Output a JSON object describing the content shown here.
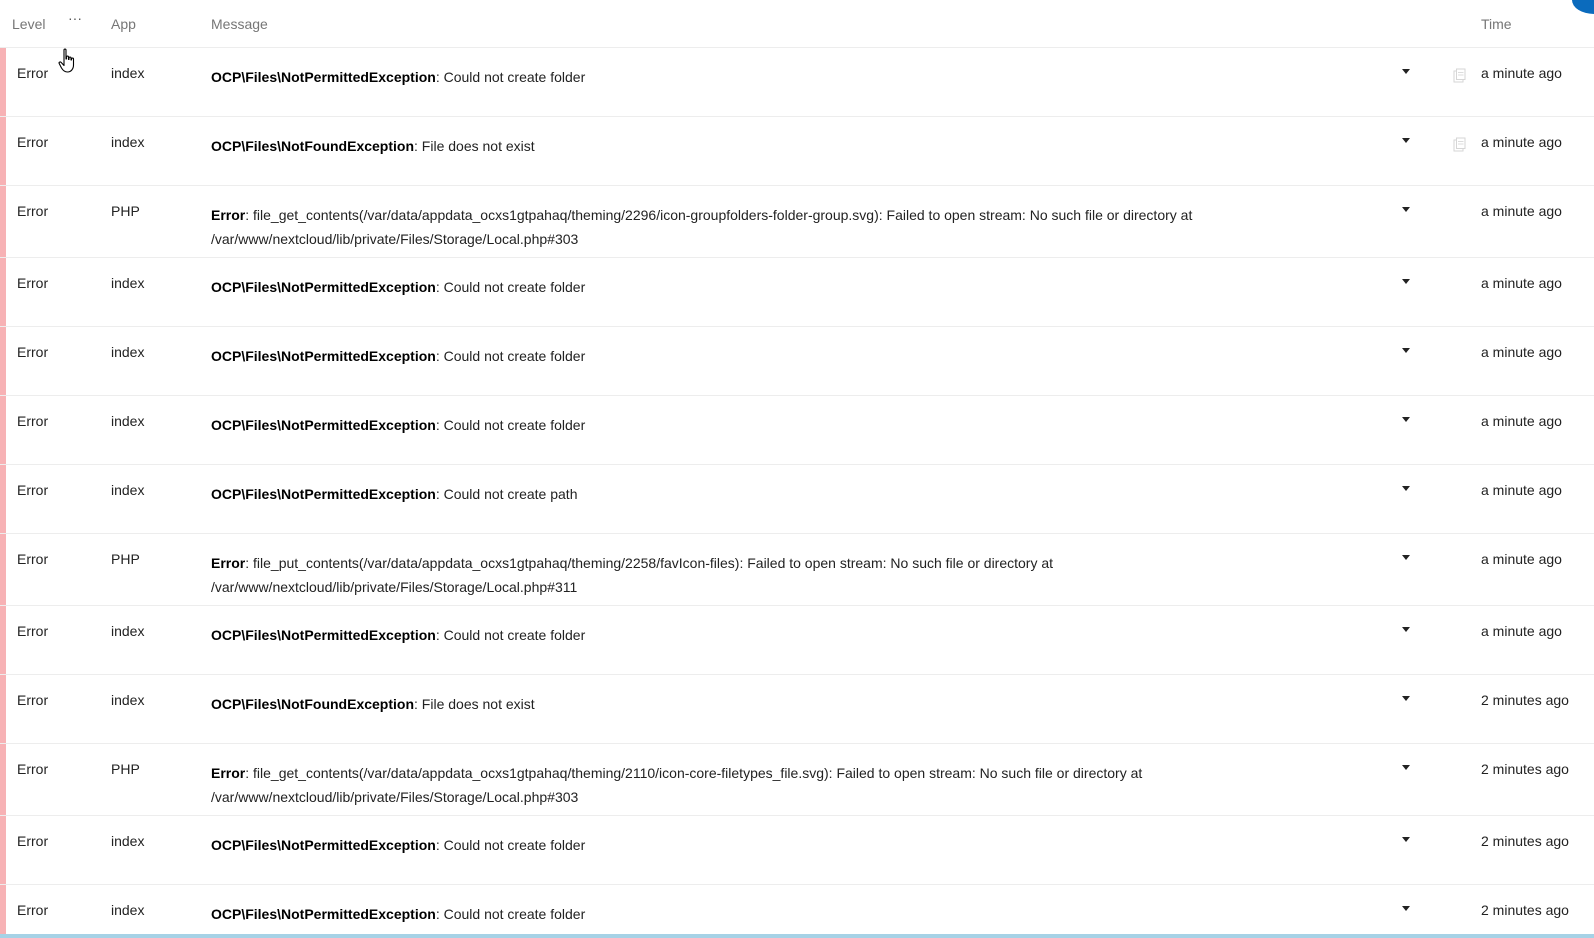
{
  "header": {
    "level": "Level",
    "more": "···",
    "app": "App",
    "message": "Message",
    "time": "Time"
  },
  "icons": {
    "more": "more-dots-icon",
    "caret": "caret-down-icon",
    "copy": "copy-icon",
    "cursor": "hand-pointer-icon"
  },
  "colors": {
    "error_bar": "#f7b2b5",
    "header_text": "#767676",
    "divider": "#ededed",
    "scroll_strip": "#a6d2e6",
    "corner_accent": "#0b6bbd"
  },
  "rows": [
    {
      "level": "Error",
      "app": "index",
      "exception": "OCP\\Files\\NotPermittedException",
      "message": ": Could not create folder",
      "message_line2": "",
      "time": "a minute ago",
      "copy_icon": true
    },
    {
      "level": "Error",
      "app": "index",
      "exception": "OCP\\Files\\NotFoundException",
      "message": ": File does not exist",
      "message_line2": "",
      "time": "a minute ago",
      "copy_icon": true
    },
    {
      "level": "Error",
      "app": "PHP",
      "exception": "Error",
      "message": ": file_get_contents(/var/data/appdata_ocxs1gtpahaq/theming/2296/icon-groupfolders-folder-group.svg): Failed to open stream: No such file or directory at",
      "message_line2": "/var/www/nextcloud/lib/private/Files/Storage/Local.php#303",
      "time": "a minute ago",
      "copy_icon": false
    },
    {
      "level": "Error",
      "app": "index",
      "exception": "OCP\\Files\\NotPermittedException",
      "message": ": Could not create folder",
      "message_line2": "",
      "time": "a minute ago",
      "copy_icon": false
    },
    {
      "level": "Error",
      "app": "index",
      "exception": "OCP\\Files\\NotPermittedException",
      "message": ": Could not create folder",
      "message_line2": "",
      "time": "a minute ago",
      "copy_icon": false
    },
    {
      "level": "Error",
      "app": "index",
      "exception": "OCP\\Files\\NotPermittedException",
      "message": ": Could not create folder",
      "message_line2": "",
      "time": "a minute ago",
      "copy_icon": false
    },
    {
      "level": "Error",
      "app": "index",
      "exception": "OCP\\Files\\NotPermittedException",
      "message": ": Could not create path",
      "message_line2": "",
      "time": "a minute ago",
      "copy_icon": false
    },
    {
      "level": "Error",
      "app": "PHP",
      "exception": "Error",
      "message": ": file_put_contents(/var/data/appdata_ocxs1gtpahaq/theming/2258/favIcon-files): Failed to open stream: No such file or directory at",
      "message_line2": "/var/www/nextcloud/lib/private/Files/Storage/Local.php#311",
      "time": "a minute ago",
      "copy_icon": false
    },
    {
      "level": "Error",
      "app": "index",
      "exception": "OCP\\Files\\NotPermittedException",
      "message": ": Could not create folder",
      "message_line2": "",
      "time": "a minute ago",
      "copy_icon": false
    },
    {
      "level": "Error",
      "app": "index",
      "exception": "OCP\\Files\\NotFoundException",
      "message": ": File does not exist",
      "message_line2": "",
      "time": "2 minutes ago",
      "copy_icon": false
    },
    {
      "level": "Error",
      "app": "PHP",
      "exception": "Error",
      "message": ": file_get_contents(/var/data/appdata_ocxs1gtpahaq/theming/2110/icon-core-filetypes_file.svg): Failed to open stream: No such file or directory at",
      "message_line2": "/var/www/nextcloud/lib/private/Files/Storage/Local.php#303",
      "time": "2 minutes ago",
      "copy_icon": false
    },
    {
      "level": "Error",
      "app": "index",
      "exception": "OCP\\Files\\NotPermittedException",
      "message": ": Could not create folder",
      "message_line2": "",
      "time": "2 minutes ago",
      "copy_icon": false
    },
    {
      "level": "Error",
      "app": "index",
      "exception": "OCP\\Files\\NotPermittedException",
      "message": ": Could not create folder",
      "message_line2": "",
      "time": "2 minutes ago",
      "copy_icon": false
    }
  ]
}
